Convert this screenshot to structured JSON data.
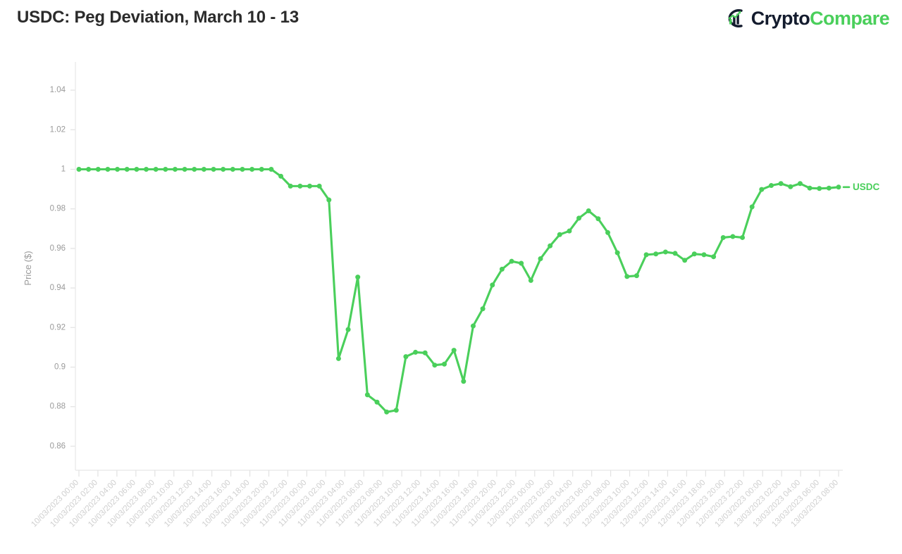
{
  "header": {
    "title": "USDC: Peg Deviation, March 10 - 13",
    "brand": {
      "mark_icon": "chart-circle-icon",
      "word_primary": "Crypto",
      "word_secondary": "Compare",
      "color_primary": "#141c2e",
      "color_secondary": "#4ACF5B"
    }
  },
  "colors": {
    "series": "#4ACF5B",
    "axis": "#ebebeb",
    "tick_label": "#9a9a9a",
    "xtick_label": "#cfcfcf",
    "title": "#2b2b2b",
    "background": "#ffffff"
  },
  "legend": {
    "position": "right-of-last-point",
    "entries": [
      {
        "label": "USDC",
        "color": "#4ACF5B",
        "marker": "circle-dash"
      }
    ]
  },
  "chart_data": {
    "type": "line",
    "title": "USDC: Peg Deviation, March 10 - 13",
    "xlabel": "",
    "ylabel": "Price ($)",
    "ylim": [
      0.85,
      1.05
    ],
    "yticks": [
      0.86,
      0.88,
      0.9,
      0.92,
      0.94,
      0.96,
      0.98,
      1,
      1.02,
      1.04
    ],
    "ytick_labels": [
      "0.86",
      "0.88",
      "0.9",
      "0.92",
      "0.94",
      "0.96",
      "0.98",
      "1",
      "1.02",
      "1.04"
    ],
    "grid": false,
    "marker": "circle",
    "x_tick_rotation": -45,
    "x_tick_interval_hours": 2,
    "categories": [
      "10/03/2023 00:00",
      "10/03/2023 02:00",
      "10/03/2023 04:00",
      "10/03/2023 06:00",
      "10/03/2023 08:00",
      "10/03/2023 10:00",
      "10/03/2023 12:00",
      "10/03/2023 14:00",
      "10/03/2023 16:00",
      "10/03/2023 18:00",
      "10/03/2023 20:00",
      "10/03/2023 22:00",
      "11/03/2023 00:00",
      "11/03/2023 02:00",
      "11/03/2023 04:00",
      "11/03/2023 06:00",
      "11/03/2023 08:00",
      "11/03/2023 10:00",
      "11/03/2023 12:00",
      "11/03/2023 14:00",
      "11/03/2023 16:00",
      "11/03/2023 18:00",
      "11/03/2023 20:00",
      "11/03/2023 22:00",
      "12/03/2023 00:00",
      "12/03/2023 02:00",
      "12/03/2023 04:00",
      "12/03/2023 06:00",
      "12/03/2023 08:00",
      "12/03/2023 10:00",
      "12/03/2023 12:00",
      "12/03/2023 14:00",
      "12/03/2023 16:00",
      "12/03/2023 18:00",
      "12/03/2023 20:00",
      "12/03/2023 22:00",
      "13/03/2023 00:00",
      "13/03/2023 02:00",
      "13/03/2023 04:00",
      "13/03/2023 06:00",
      "13/03/2023 08:00"
    ],
    "series": [
      {
        "name": "USDC",
        "color": "#4ACF5B",
        "x": [
          0,
          1,
          2,
          3,
          4,
          5,
          6,
          7,
          8,
          9,
          10,
          11,
          12,
          13,
          14,
          15,
          16,
          17,
          18,
          19,
          20,
          21,
          22,
          23,
          24,
          25,
          26,
          27,
          28,
          29,
          30,
          31,
          32,
          33,
          34,
          35,
          36,
          37,
          38,
          39,
          40,
          41,
          42,
          43,
          44,
          45,
          46,
          47,
          48,
          49,
          50,
          51,
          52,
          53,
          54,
          55,
          56,
          57,
          58,
          59,
          60,
          61,
          62,
          63,
          64,
          65,
          66,
          67,
          68,
          69,
          70,
          71,
          72,
          73,
          74,
          75,
          76,
          77,
          78,
          79
        ],
        "values": [
          1.0,
          1.0,
          1.0,
          1.0,
          1.0,
          1.0,
          1.0,
          1.0,
          1.0,
          1.0,
          1.0,
          1.0,
          1.0,
          1.0,
          1.0,
          1.0,
          1.0,
          1.0,
          1.0,
          1.0,
          1.0,
          0.9965,
          0.9915,
          0.9915,
          0.9915,
          0.9915,
          0.9845,
          0.9043,
          0.919,
          0.9455,
          0.886,
          0.8823,
          0.8773,
          0.8782,
          0.9053,
          0.9075,
          0.9072,
          0.901,
          0.9015,
          0.9085,
          0.8928,
          0.9208,
          0.9295,
          0.9415,
          0.9495,
          0.9535,
          0.9525,
          0.9438,
          0.9548,
          0.9613,
          0.967,
          0.9688,
          0.9753,
          0.979,
          0.975,
          0.968,
          0.9578,
          0.9458,
          0.9462,
          0.9568,
          0.9572,
          0.9582,
          0.9575,
          0.954,
          0.9572,
          0.9568,
          0.9558,
          0.9655,
          0.966,
          0.9655,
          0.981,
          0.9898,
          0.9918,
          0.9928,
          0.9912,
          0.9928,
          0.9905,
          0.9903,
          0.9905,
          0.991
        ]
      }
    ],
    "annotations": {
      "peak": 1.0,
      "trough": 0.8773,
      "final": 0.991
    }
  }
}
